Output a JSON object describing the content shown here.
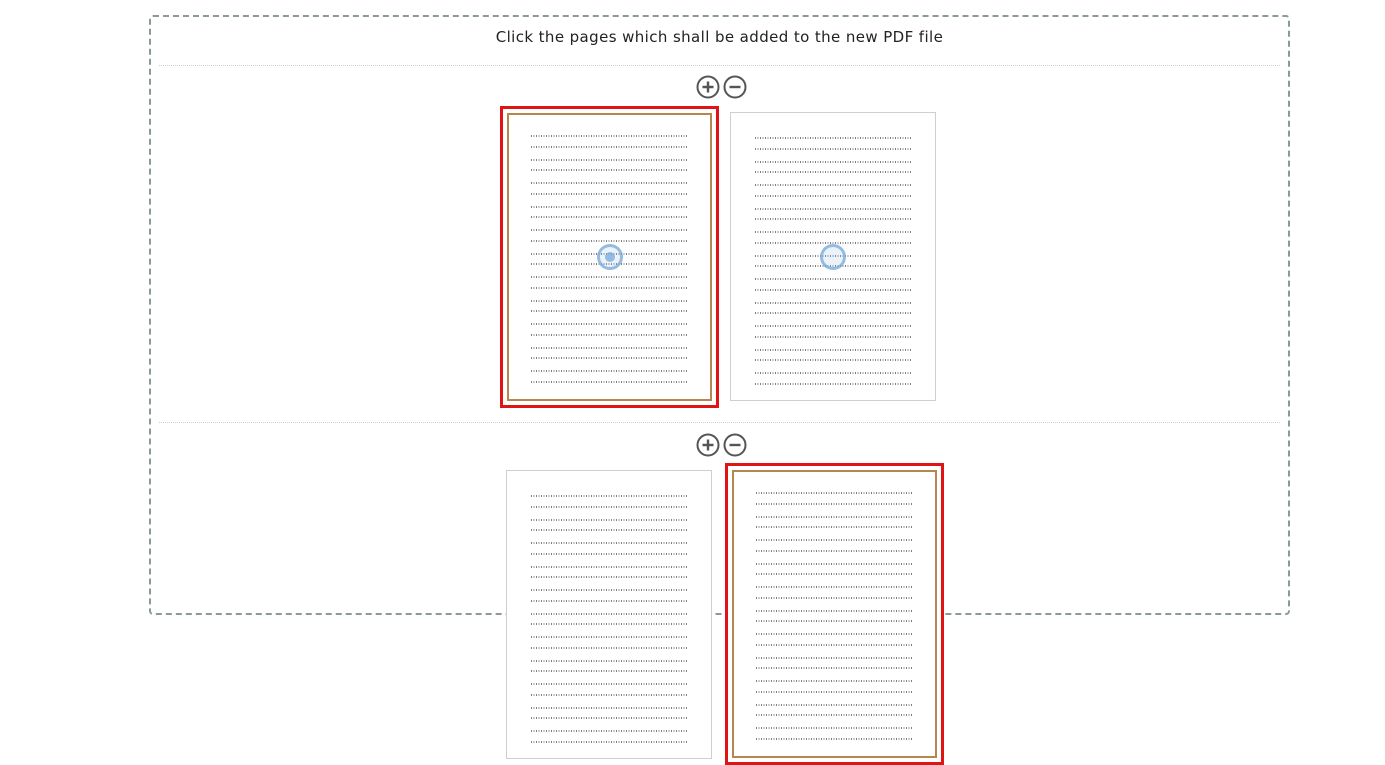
{
  "instruction": "Click the pages which shall be added to the new PDF file",
  "zoom": {
    "zoom_in_icon": "plus-circle-icon",
    "zoom_out_icon": "minus-circle-icon"
  },
  "documents": [
    {
      "pages": [
        {
          "page": 1,
          "selected": true
        },
        {
          "page": 2,
          "selected": false
        }
      ]
    },
    {
      "pages": [
        {
          "page": 1,
          "selected": false
        },
        {
          "page": 2,
          "selected": true
        }
      ]
    }
  ],
  "colors": {
    "selected_border": "#e01414",
    "panel_border": "#8a9a9a",
    "cursor_highlight": "#78aad7"
  }
}
